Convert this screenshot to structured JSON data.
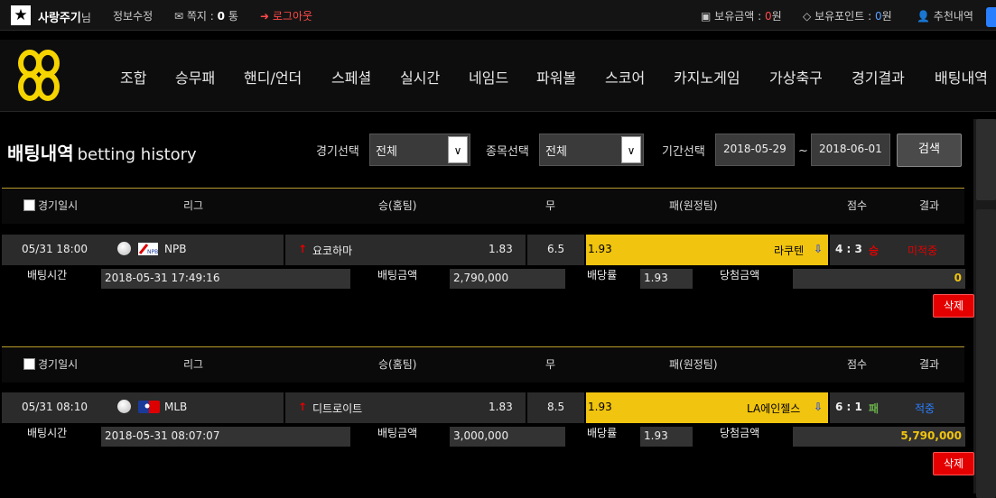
{
  "topbar": {
    "username": "사랑주기",
    "honorific": "님",
    "edit_profile": "정보수정",
    "notes_label": "쪽지 :",
    "notes_count": "0",
    "notes_unit": "통",
    "logout": "로그아웃",
    "balance_label": "보유금액 :",
    "balance_value": "0",
    "balance_unit": "원",
    "points_label": "보유포인트 :",
    "points_value": "0",
    "points_unit": "원",
    "referral": "추천내역"
  },
  "nav": {
    "items": [
      "조합",
      "승무패",
      "핸디/언더",
      "스페셜",
      "실시간",
      "네임드",
      "파워볼",
      "스코어",
      "카지노게임",
      "가상축구",
      "경기결과",
      "배팅내역"
    ]
  },
  "page": {
    "title": "배팅내역",
    "subtitle": "betting history"
  },
  "filters": {
    "game_label": "경기선택",
    "game_value": "전체",
    "sport_label": "종목선택",
    "sport_value": "전체",
    "period_label": "기간선택",
    "date_from": "2018-05-29",
    "separator": "~",
    "date_to": "2018-06-01",
    "search_button": "검색"
  },
  "columns": {
    "date": "경기일시",
    "league": "리그",
    "home": "승(홈팀)",
    "draw": "무",
    "away": "패(원정팀)",
    "score": "점수",
    "result": "결과"
  },
  "bets": [
    {
      "date": "05/31 18:00",
      "league": "NPB",
      "home_team": "요코하마",
      "home_odds": "1.83",
      "draw_odds": "6.5",
      "away_odds": "1.93",
      "away_team": "라쿠텐",
      "score": "4 : 3",
      "score_outcome": "승",
      "result": "미적중",
      "result_color": "#e50000",
      "bet_time_label": "배팅시간",
      "bet_time": "2018-05-31 17:49:16",
      "bet_amount_label": "배팅금액",
      "bet_amount": "2,790,000",
      "odds_label": "배당률",
      "odds": "1.93",
      "win_label": "당첨금액",
      "win_amount": "0",
      "delete": "삭제"
    },
    {
      "date": "05/31 08:10",
      "league": "MLB",
      "home_team": "디트로이트",
      "home_odds": "1.83",
      "draw_odds": "8.5",
      "away_odds": "1.93",
      "away_team": "LA에인젤스",
      "score": "6 : 1",
      "score_outcome": "패",
      "result": "적중",
      "result_color": "#2a7fff",
      "bet_time_label": "배팅시간",
      "bet_time": "2018-05-31 08:07:07",
      "bet_amount_label": "배팅금액",
      "bet_amount": "3,000,000",
      "odds_label": "배당률",
      "odds": "1.93",
      "win_label": "당첨금액",
      "win_amount": "5,790,000",
      "delete": "삭제"
    }
  ],
  "colors": {
    "accent_yellow": "#f1c40f",
    "delete_red": "#e50000",
    "win_blue": "#2a7fff",
    "score_win_red": "#e50000",
    "score_lose_green": "#6ab04c"
  }
}
